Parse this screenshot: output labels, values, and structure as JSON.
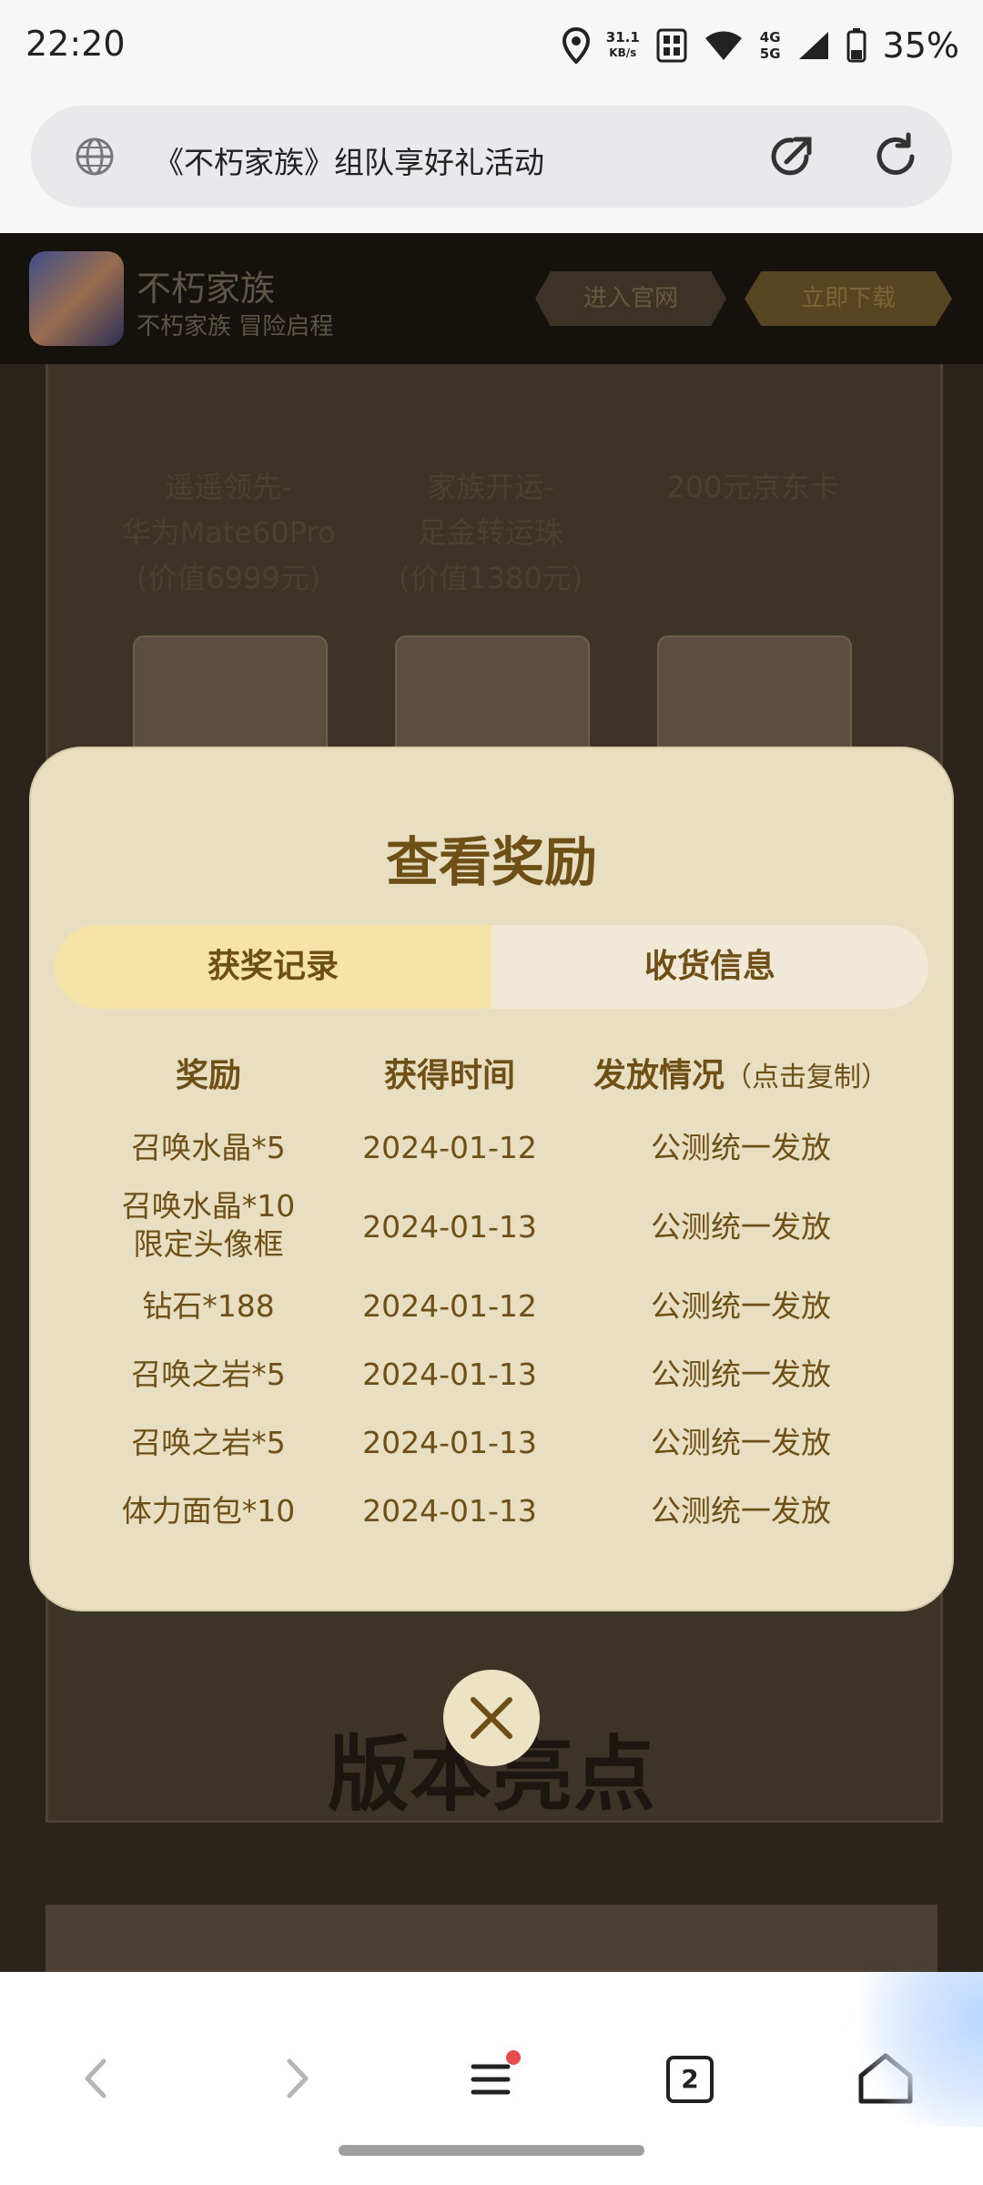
{
  "status_bar": {
    "time": "22:20",
    "net_speed_value": "31.1",
    "net_speed_unit": "KB/s",
    "net_top": "4G",
    "net_bottom": "5G",
    "battery": "35%"
  },
  "browser": {
    "page_title": "《不朽家族》组队享好礼活动"
  },
  "app_banner": {
    "name": "不朽家族",
    "subtitle": "不朽家族 冒险启程",
    "enter_label": "进入官网",
    "download_label": "立即下载"
  },
  "background_prizes": [
    {
      "text": "遥遥领先-\n华为Mate60Pro\n(价值6999元)"
    },
    {
      "text": "家族开运-\n足金转运珠\n(价值1380元)"
    },
    {
      "text": "200元京东卡"
    }
  ],
  "section": {
    "title": "版本亮点"
  },
  "modal": {
    "title": "查看奖励",
    "tabs": [
      {
        "label": "获奖记录",
        "active": true
      },
      {
        "label": "收货信息",
        "active": false
      }
    ],
    "columns": {
      "reward": "奖励",
      "time": "获得时间",
      "status": "发放情况",
      "status_note": "（点击复制）"
    },
    "rows": [
      {
        "reward": "召唤水晶*5",
        "time": "2024-01-12",
        "status": "公测统一发放"
      },
      {
        "reward": "召唤水晶*10\n限定头像框",
        "time": "2024-01-13",
        "status": "公测统一发放"
      },
      {
        "reward": "钻石*188",
        "time": "2024-01-12",
        "status": "公测统一发放"
      },
      {
        "reward": "召唤之岩*5",
        "time": "2024-01-13",
        "status": "公测统一发放"
      },
      {
        "reward": "召唤之岩*5",
        "time": "2024-01-13",
        "status": "公测统一发放"
      },
      {
        "reward": "体力面包*10",
        "time": "2024-01-13",
        "status": "公测统一发放"
      }
    ]
  },
  "nav": {
    "tab_count": "2"
  },
  "colors": {
    "modal_bg": "#e8dfc2",
    "accent_text": "#6e4f16",
    "active_tab": "#f5e3a8"
  }
}
